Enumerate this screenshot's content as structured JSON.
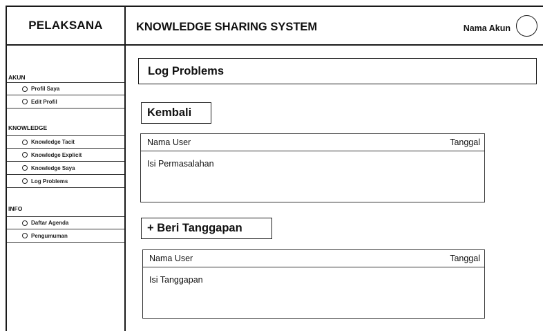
{
  "header": {
    "brand": "PELAKSANA",
    "app_title": "KNOWLEDGE SHARING SYSTEM",
    "account_name": "Nama Akun",
    "avatar_icon": "avatar-circle-icon"
  },
  "sidebar": {
    "sections": [
      {
        "title": "AKUN",
        "items": [
          "Profil Saya",
          "Edit Profil"
        ]
      },
      {
        "title": "KNOWLEDGE",
        "items": [
          "Knowledge Tacit",
          "Knowledge Explicit",
          "Knowledge Saya",
          "Log Problems"
        ]
      },
      {
        "title": "INFO",
        "items": [
          "Daftar Agenda",
          "Pengumuman"
        ]
      }
    ],
    "bullet_icon": "circle-bullet-icon"
  },
  "main": {
    "page_title": "Log Problems",
    "back_button": "Kembali",
    "problem": {
      "user": "Nama User",
      "date": "Tanggal",
      "body": "Isi Permasalahan"
    },
    "reply_button": "+ Beri Tanggapan",
    "response": {
      "user": "Nama User",
      "date": "Tanggal",
      "body": "Isi Tanggapan"
    }
  }
}
